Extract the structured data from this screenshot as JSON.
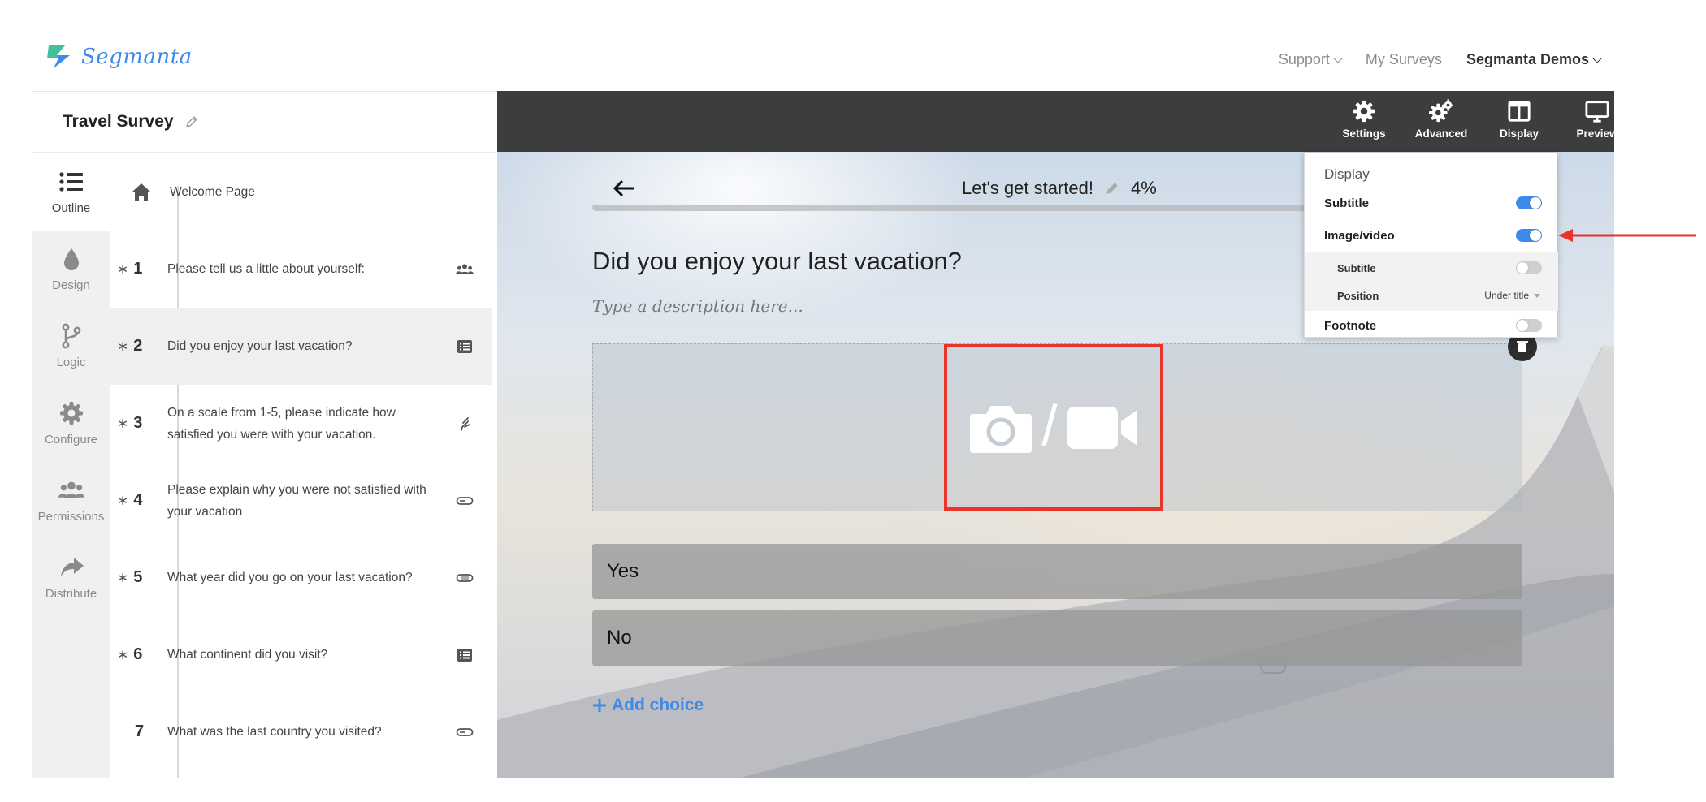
{
  "brand": {
    "name": "Segmanta",
    "accent": "#3d8be8"
  },
  "nav": {
    "support": "Support",
    "my_surveys": "My Surveys",
    "account": "Segmanta Demos"
  },
  "survey": {
    "title": "Travel Survey"
  },
  "rail": [
    {
      "label": "Outline",
      "icon": "list-icon",
      "active": true
    },
    {
      "label": "Design",
      "icon": "drop-icon"
    },
    {
      "label": "Logic",
      "icon": "branch-icon"
    },
    {
      "label": "Configure",
      "icon": "gear-icon"
    },
    {
      "label": "Permissions",
      "icon": "users-icon"
    },
    {
      "label": "Distribute",
      "icon": "share-icon"
    }
  ],
  "outline": {
    "welcome": "Welcome Page",
    "items": [
      {
        "num": "1",
        "star": "∗",
        "text": "Please tell us a little about yourself:",
        "icon": "users-icon"
      },
      {
        "num": "2",
        "star": "∗",
        "text": "Did you enjoy your last vacation?",
        "icon": "list-box-icon"
      },
      {
        "num": "3",
        "star": "∗",
        "text": "On a scale from 1-5, please indicate how satisfied you were with your vacation.",
        "icon": "scale-icon"
      },
      {
        "num": "4",
        "star": "∗",
        "text": "Please explain why you were not satisfied with your vacation",
        "icon": "text-field-icon"
      },
      {
        "num": "5",
        "star": "∗",
        "text": "What year did you go on your last vacation?",
        "icon": "number-field-icon"
      },
      {
        "num": "6",
        "star": "∗",
        "text": "What continent did you visit?",
        "icon": "list-box-icon"
      },
      {
        "num": "7",
        "star": "",
        "text": "What was the last country you visited?",
        "icon": "text-field-icon"
      }
    ]
  },
  "toolbar": {
    "settings": "Settings",
    "advanced": "Advanced",
    "display": "Display",
    "preview": "Preview"
  },
  "editor": {
    "page_title": "Let's get started!",
    "progress": "4%",
    "progress_fraction": 0.04,
    "question_title": "Did you enjoy your last vacation?",
    "description_placeholder": "Type a description here...",
    "media_separator": "/",
    "choices": [
      "Yes",
      "No"
    ],
    "add_choice": "Add choice"
  },
  "display_panel": {
    "header": "Display",
    "subtitle": "Subtitle",
    "image_video": "Image/video",
    "media_subtitle": "Subtitle",
    "position": "Position",
    "position_value": "Under title",
    "footnote": "Footnote",
    "subtitle_on": true,
    "image_video_on": true,
    "media_subtitle_on": false,
    "footnote_on": false
  },
  "colors": {
    "highlight_red": "#e8342b",
    "toolbar_bg": "#3d3d3d"
  }
}
